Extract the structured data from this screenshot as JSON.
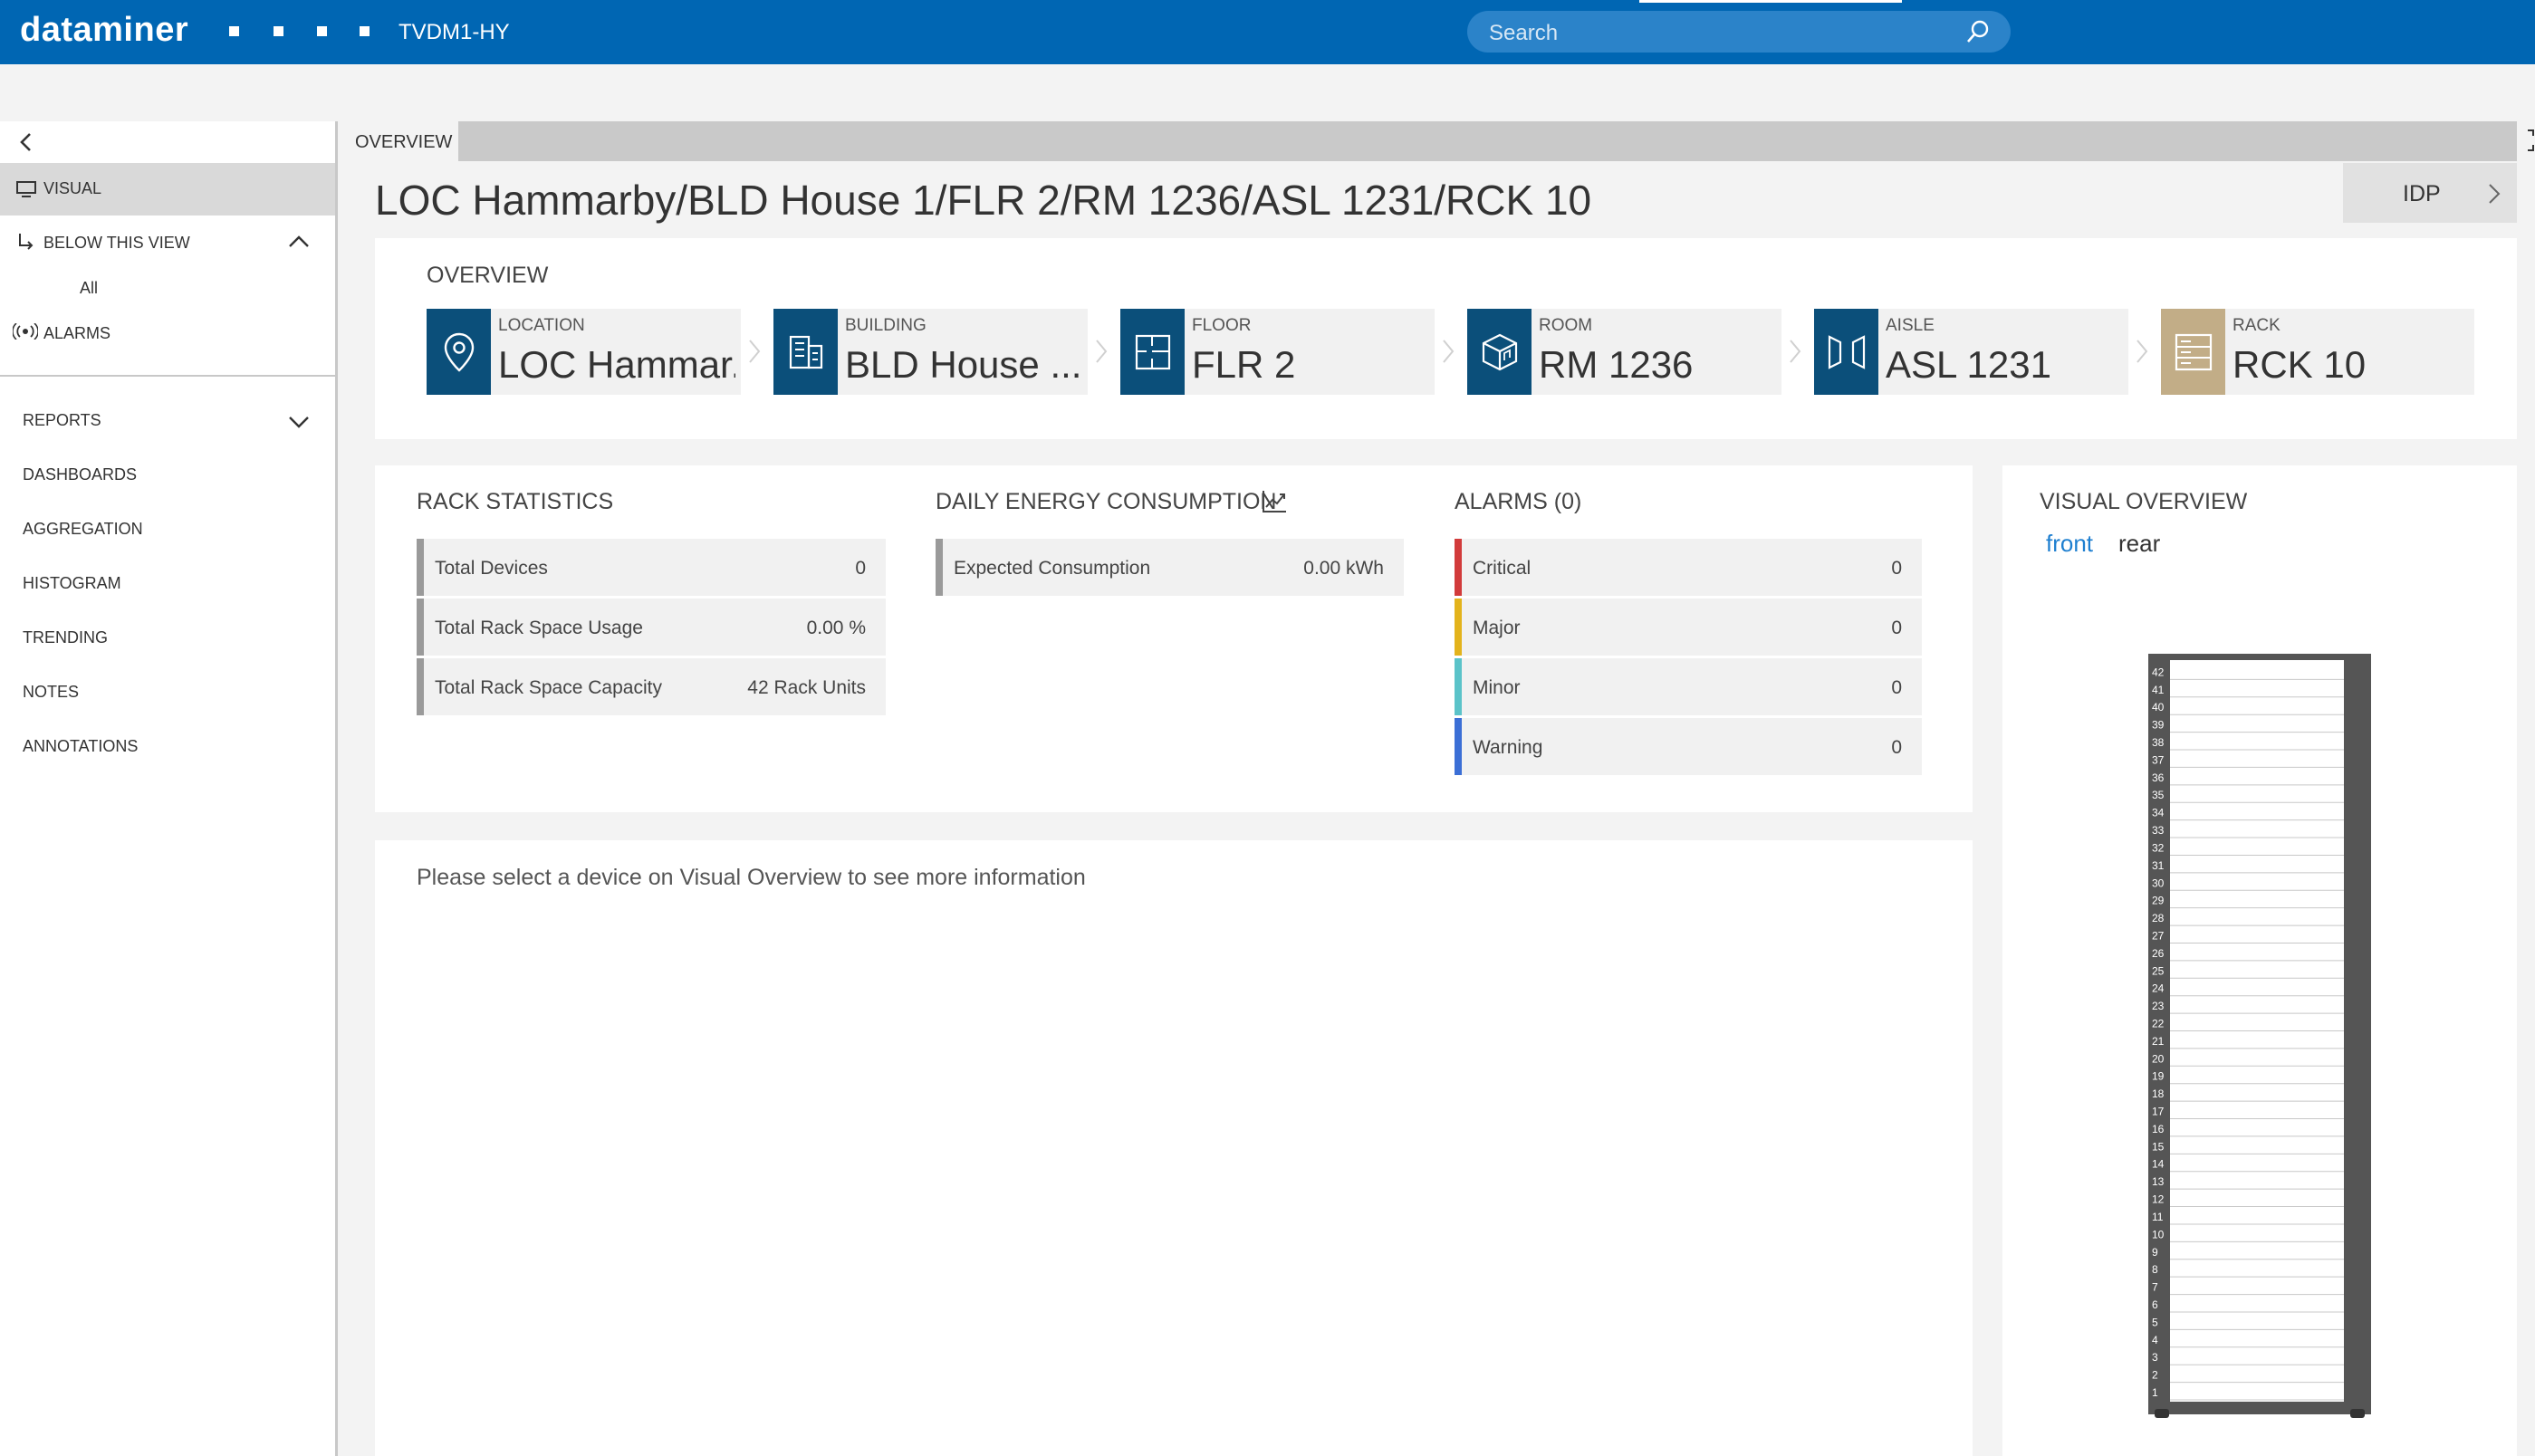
{
  "header": {
    "brand": "dataminer",
    "host": "TVDM1-HY",
    "search_placeholder": "Search",
    "search_icon": "search-icon"
  },
  "sidebar": {
    "visual_label": "VISUAL",
    "below_label": "BELOW THIS VIEW",
    "below_all": "All",
    "alarms_label": "ALARMS",
    "items": [
      {
        "label": "REPORTS"
      },
      {
        "label": "DASHBOARDS"
      },
      {
        "label": "AGGREGATION"
      },
      {
        "label": "HISTOGRAM"
      },
      {
        "label": "TRENDING"
      },
      {
        "label": "NOTES"
      },
      {
        "label": "ANNOTATIONS"
      }
    ]
  },
  "tabs": [
    {
      "label": "OVERVIEW"
    }
  ],
  "title": "LOC Hammarby/BLD House 1/FLR 2/RM 1236/ASL 1231/RCK 10",
  "idp_label": "IDP",
  "overview": {
    "heading": "OVERVIEW",
    "crumbs": [
      {
        "caption": "LOCATION",
        "value": "LOC Hammar...",
        "icon": "location-pin-icon",
        "color": "#0b4f7a"
      },
      {
        "caption": "BUILDING",
        "value": "BLD House ...",
        "icon": "building-icon",
        "color": "#0b4f7a"
      },
      {
        "caption": "FLOOR",
        "value": "FLR 2",
        "icon": "floor-plan-icon",
        "color": "#0b4f7a"
      },
      {
        "caption": "ROOM",
        "value": "RM 1236",
        "icon": "room-cube-icon",
        "color": "#0b4f7a"
      },
      {
        "caption": "AISLE",
        "value": "ASL 1231",
        "icon": "aisle-icon",
        "color": "#0b4f7a"
      },
      {
        "caption": "RACK",
        "value": "RCK 10",
        "icon": "rack-icon",
        "color": "#c2ad87"
      }
    ]
  },
  "rack_stats": {
    "heading": "RACK STATISTICS",
    "rows": [
      {
        "label": "Total Devices",
        "value": "0"
      },
      {
        "label": "Total Rack Space Usage",
        "value": "0.00 %"
      },
      {
        "label": "Total Rack Space Capacity",
        "value": "42 Rack Units"
      }
    ]
  },
  "energy": {
    "heading": "DAILY ENERGY CONSUMPTION",
    "rows": [
      {
        "label": "Expected Consumption",
        "value": "0.00 kWh"
      }
    ]
  },
  "alarms": {
    "heading": "ALARMS (0)",
    "rows": [
      {
        "label": "Critical",
        "value": "0",
        "color": "#d23b3b"
      },
      {
        "label": "Major",
        "value": "0",
        "color": "#e3b31c"
      },
      {
        "label": "Minor",
        "value": "0",
        "color": "#5bc3c9"
      },
      {
        "label": "Warning",
        "value": "0",
        "color": "#3b6fd6"
      }
    ]
  },
  "details_hint": "Please select a device on Visual Overview to see more information",
  "visual_overview": {
    "heading": "VISUAL OVERVIEW",
    "front": "front",
    "rear": "rear",
    "rack_units": [
      "42",
      "41",
      "40",
      "39",
      "38",
      "37",
      "36",
      "35",
      "34",
      "33",
      "32",
      "31",
      "30",
      "29",
      "28",
      "27",
      "26",
      "25",
      "24",
      "23",
      "22",
      "21",
      "20",
      "19",
      "18",
      "17",
      "16",
      "15",
      "14",
      "13",
      "12",
      "11",
      "10",
      "9",
      "8",
      "7",
      "6",
      "5",
      "4",
      "3",
      "2",
      "1"
    ]
  },
  "colors": {
    "accent": "#0066b3",
    "link": "#1e7fd0",
    "crumb_icon_bg": "#0b4f7a",
    "rack_icon_bg": "#c2ad87",
    "stat_bar": "#9a9a9a"
  }
}
